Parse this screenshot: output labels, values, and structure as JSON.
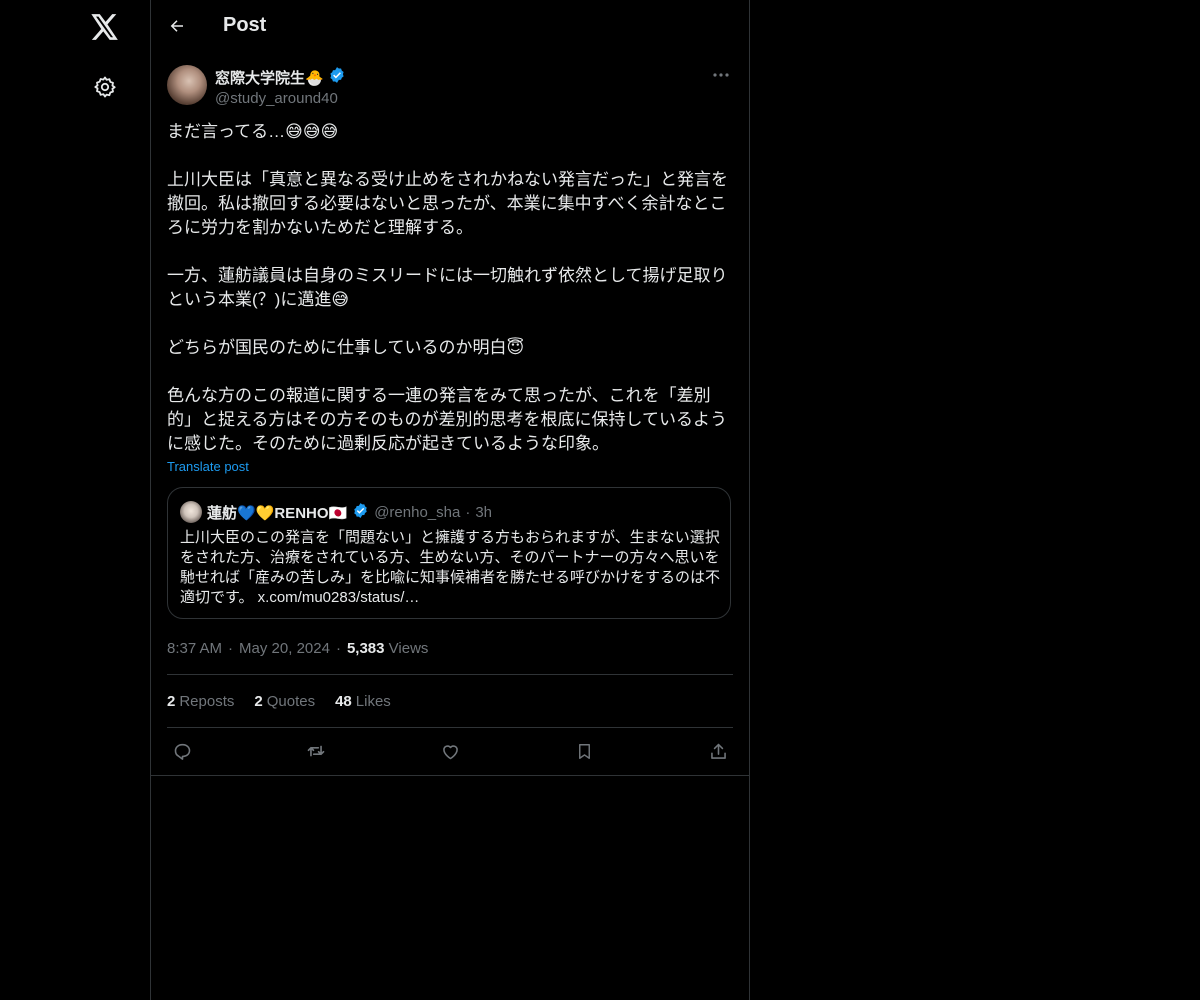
{
  "nav": {
    "logo_icon": "x-logo-icon",
    "settings_icon": "gear-icon"
  },
  "header": {
    "title": "Post",
    "back_icon": "arrow-left-icon"
  },
  "post": {
    "author_name": "窓際大学院生🐣",
    "author_handle": "@study_around40",
    "verified": true,
    "body": "まだ言ってる…😅😅😅\n\n上川大臣は「真意と異なる受け止めをされかねない発言だった」と発言を撤回。私は撤回する必要はないと思ったが、本業に集中すべく余計なところに労力を割かないためだと理解する。\n\n一方、蓮舫議員は自身のミスリードには一切触れず依然として揚げ足取りという本業(？)に邁進😅\n\nどちらが国民のために仕事しているのか明白😇\n\n色んな方のこの報道に関する一連の発言をみて思ったが、これを「差別的」と捉える方はその方そのものが差別的思考を根底に保持しているように感じた。そのために過剰反応が起きているような印象。",
    "translate_label": "Translate post",
    "quote": {
      "name": "蓮舫💙💛RENHO🇯🇵",
      "handle": "@renho_sha",
      "dot": "·",
      "time": "3h",
      "text": "上川大臣のこの発言を「問題ない」と擁護する方もおられますが、生まない選択をされた方、治療をされている方、生めない方、そのパートナーの方々へ思いを馳せれば「産みの苦しみ」を比喩に知事候補者を勝たせる呼びかけをするのは不適切です。 x.com/mu0283/status/…"
    },
    "time": "8:37 AM",
    "date": "May 20, 2024",
    "sep": "·",
    "views_count": "5,383",
    "views_label": "Views",
    "stats": {
      "reposts_count": "2",
      "reposts_label": "Reposts",
      "quotes_count": "2",
      "quotes_label": "Quotes",
      "likes_count": "48",
      "likes_label": "Likes"
    }
  },
  "colors": {
    "accent": "#1d9bf0",
    "text": "#e7e9ea",
    "muted": "#71767b",
    "border": "#2f3336",
    "bg": "#000000"
  }
}
